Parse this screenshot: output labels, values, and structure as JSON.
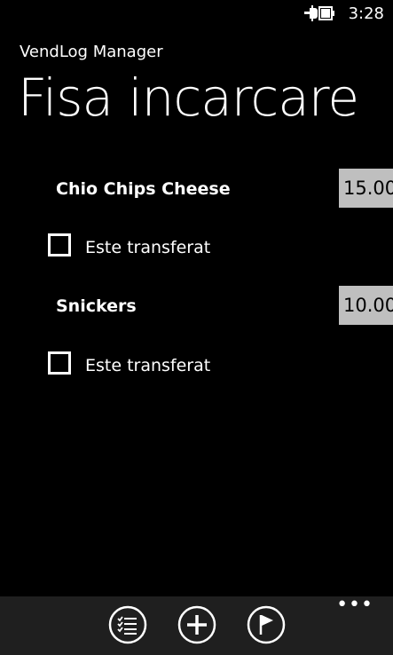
{
  "status_bar": {
    "time": "3:28",
    "battery_icon": "battery-charging-icon"
  },
  "header": {
    "app_name": "VendLog Manager",
    "page_title": "Fisa incarcare"
  },
  "items": [
    {
      "name": "Chio Chips Cheese",
      "quantity": "15.00",
      "checkbox_label": "Este transferat",
      "checked": false
    },
    {
      "name": "Snickers",
      "quantity": "10.00",
      "checkbox_label": "Este transferat",
      "checked": false
    }
  ],
  "app_bar": {
    "buttons": [
      {
        "icon": "checklist-icon"
      },
      {
        "icon": "add-icon"
      },
      {
        "icon": "flag-icon"
      }
    ],
    "more": "•••"
  },
  "colors": {
    "background": "#000000",
    "text": "#ffffff",
    "qty_field": "#bfbfbf",
    "app_bar": "#1f1f1f"
  }
}
